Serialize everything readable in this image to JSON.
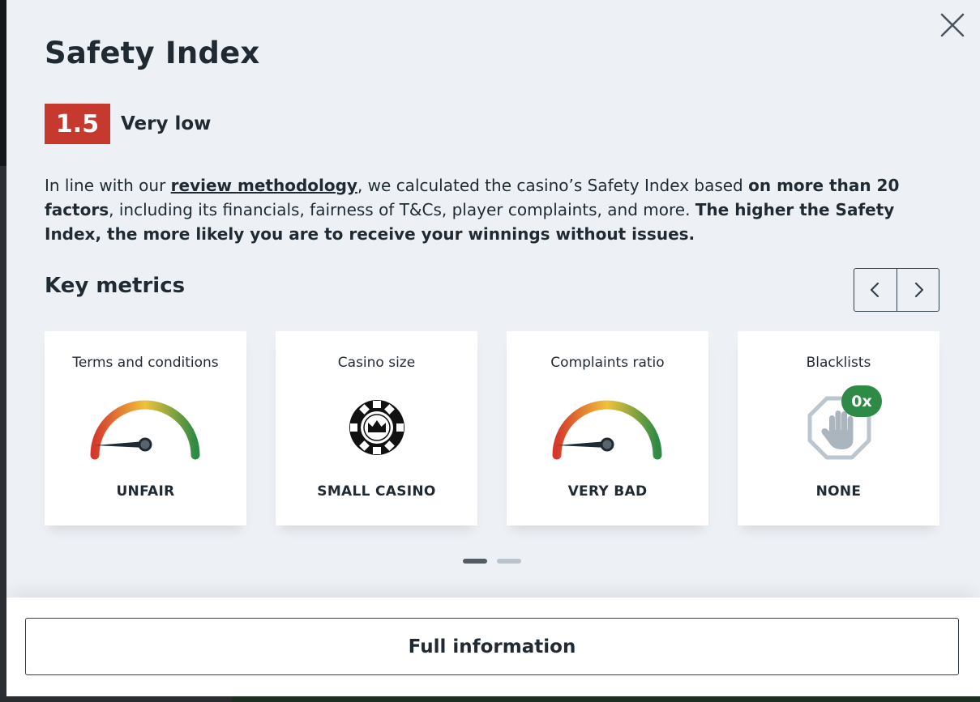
{
  "modal": {
    "title": "Safety Index",
    "score": "1.5",
    "score_label": "Very low",
    "score_color": "#c5392e",
    "description": {
      "part1": "In line with our ",
      "link": "review methodology",
      "part2": ", we calculated the casino’s Safety Index based ",
      "bold1": "on more than 20 factors",
      "part3": ", including its financials, fairness of T&Cs, player complaints, and more. ",
      "bold2": "The higher the Safety Index, the more likely you are to receive your winnings without issues."
    },
    "metrics_title": "Key metrics",
    "close_icon": "close-icon",
    "nav": {
      "prev_icon": "chevron-left-icon",
      "next_icon": "chevron-right-icon"
    },
    "cards": [
      {
        "label": "Terms and conditions",
        "value": "UNFAIR",
        "icon": "gauge-icon"
      },
      {
        "label": "Casino size",
        "value": "SMALL CASINO",
        "icon": "casino-chip-icon"
      },
      {
        "label": "Complaints ratio",
        "value": "VERY BAD",
        "icon": "gauge-icon"
      },
      {
        "label": "Blacklists",
        "value": "NONE",
        "icon": "stop-hand-icon",
        "badge": "0x"
      }
    ],
    "pagination": {
      "pages": 2,
      "current": 1
    },
    "full_button": "Full information"
  }
}
